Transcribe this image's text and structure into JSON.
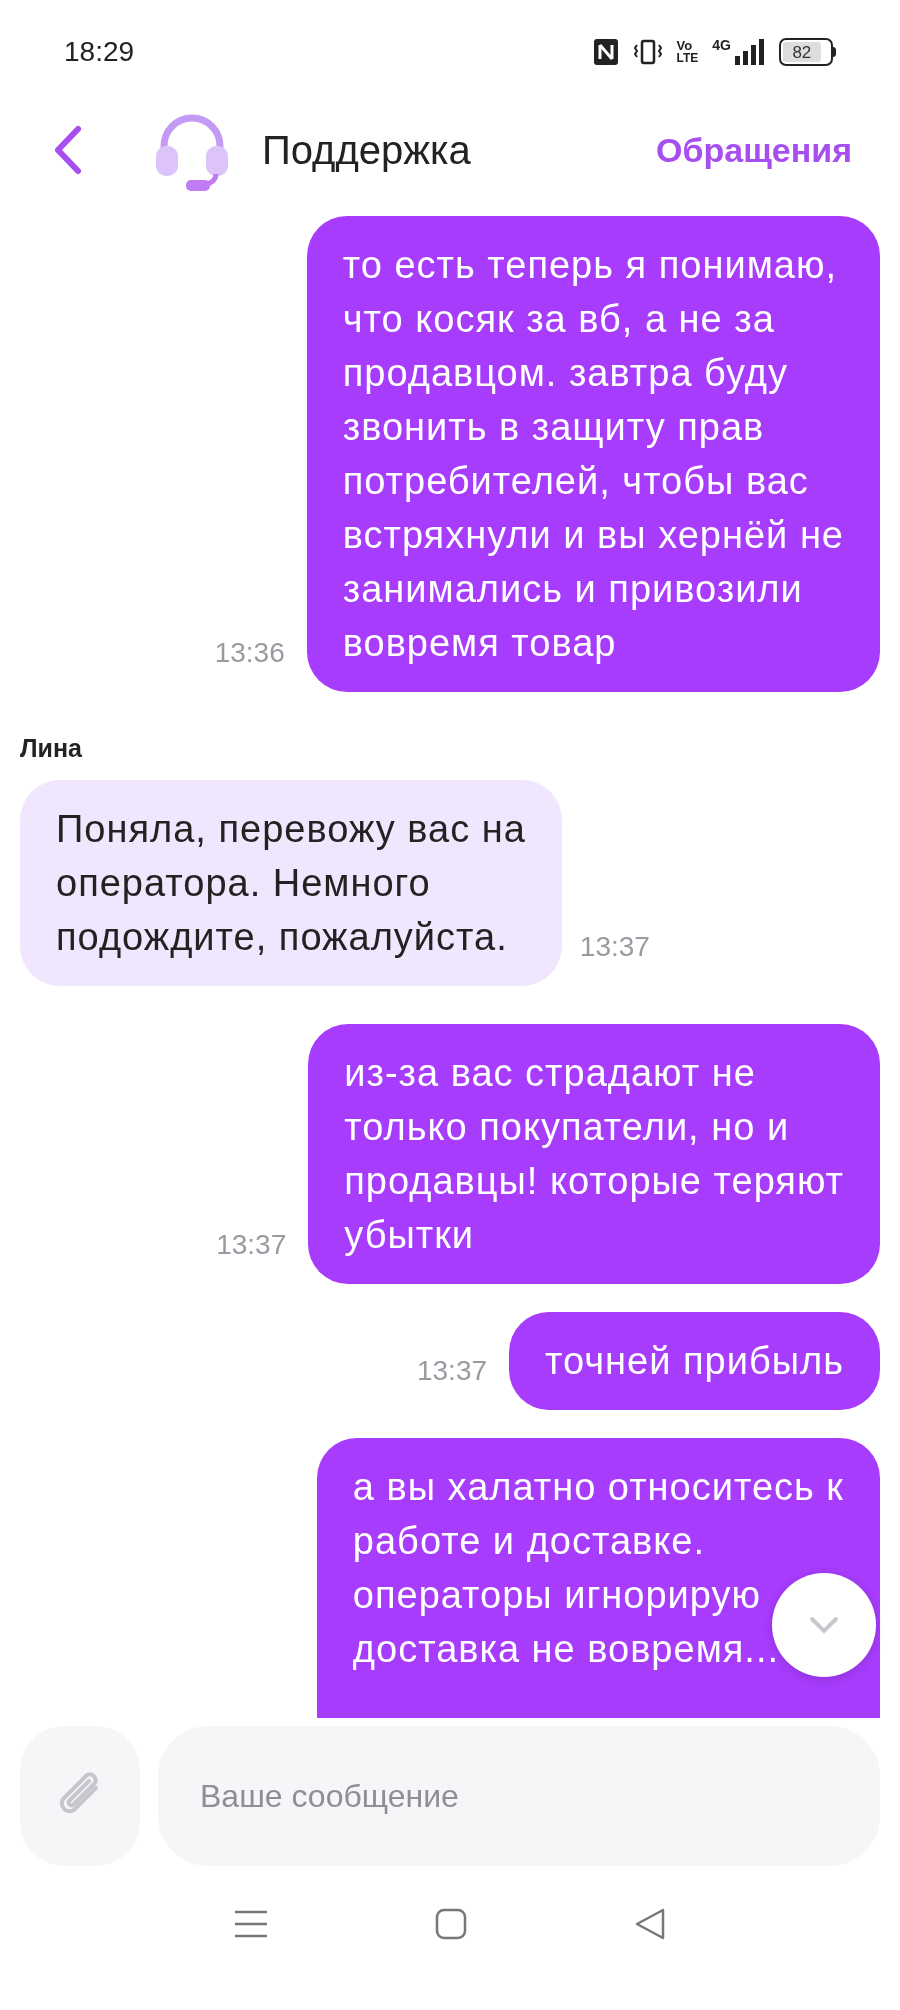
{
  "status_bar": {
    "time": "18:29",
    "volte_top": "Vo",
    "volte_bottom": "LTE",
    "network": "4G",
    "battery": "82"
  },
  "header": {
    "title": "Поддержка",
    "action": "Обращения"
  },
  "messages": [
    {
      "kind": "outgoing",
      "lines": [
        "то есть теперь я понимаю,",
        "что косяк за вб, а не за",
        "продавцом. завтра буду",
        "звонить в защиту прав",
        "потребителей, чтобы вас",
        "встряхнули и вы хернёй не",
        "занимались и привозили",
        "вовремя товар"
      ],
      "time": "13:36"
    },
    {
      "kind": "incoming",
      "author": "Лина",
      "lines": [
        "Поняла, перевожу вас на",
        "оператора. Немного",
        "подождите, пожалуйста."
      ],
      "time": "13:37"
    },
    {
      "kind": "outgoing",
      "lines": [
        "из-за вас страдают не",
        "только покупатели, но и",
        "продавцы! которые теряют",
        "убытки"
      ],
      "time": "13:37"
    },
    {
      "kind": "outgoing",
      "lines": [
        "точней прибыль"
      ],
      "time": "13:37"
    },
    {
      "kind": "outgoing",
      "lines": [
        "а вы халатно относитесь к",
        "работе и доставке.",
        "операторы игнорирую",
        "доставка не вовремя..."
      ]
    }
  ],
  "composer": {
    "placeholder": "Ваше сообщение"
  }
}
